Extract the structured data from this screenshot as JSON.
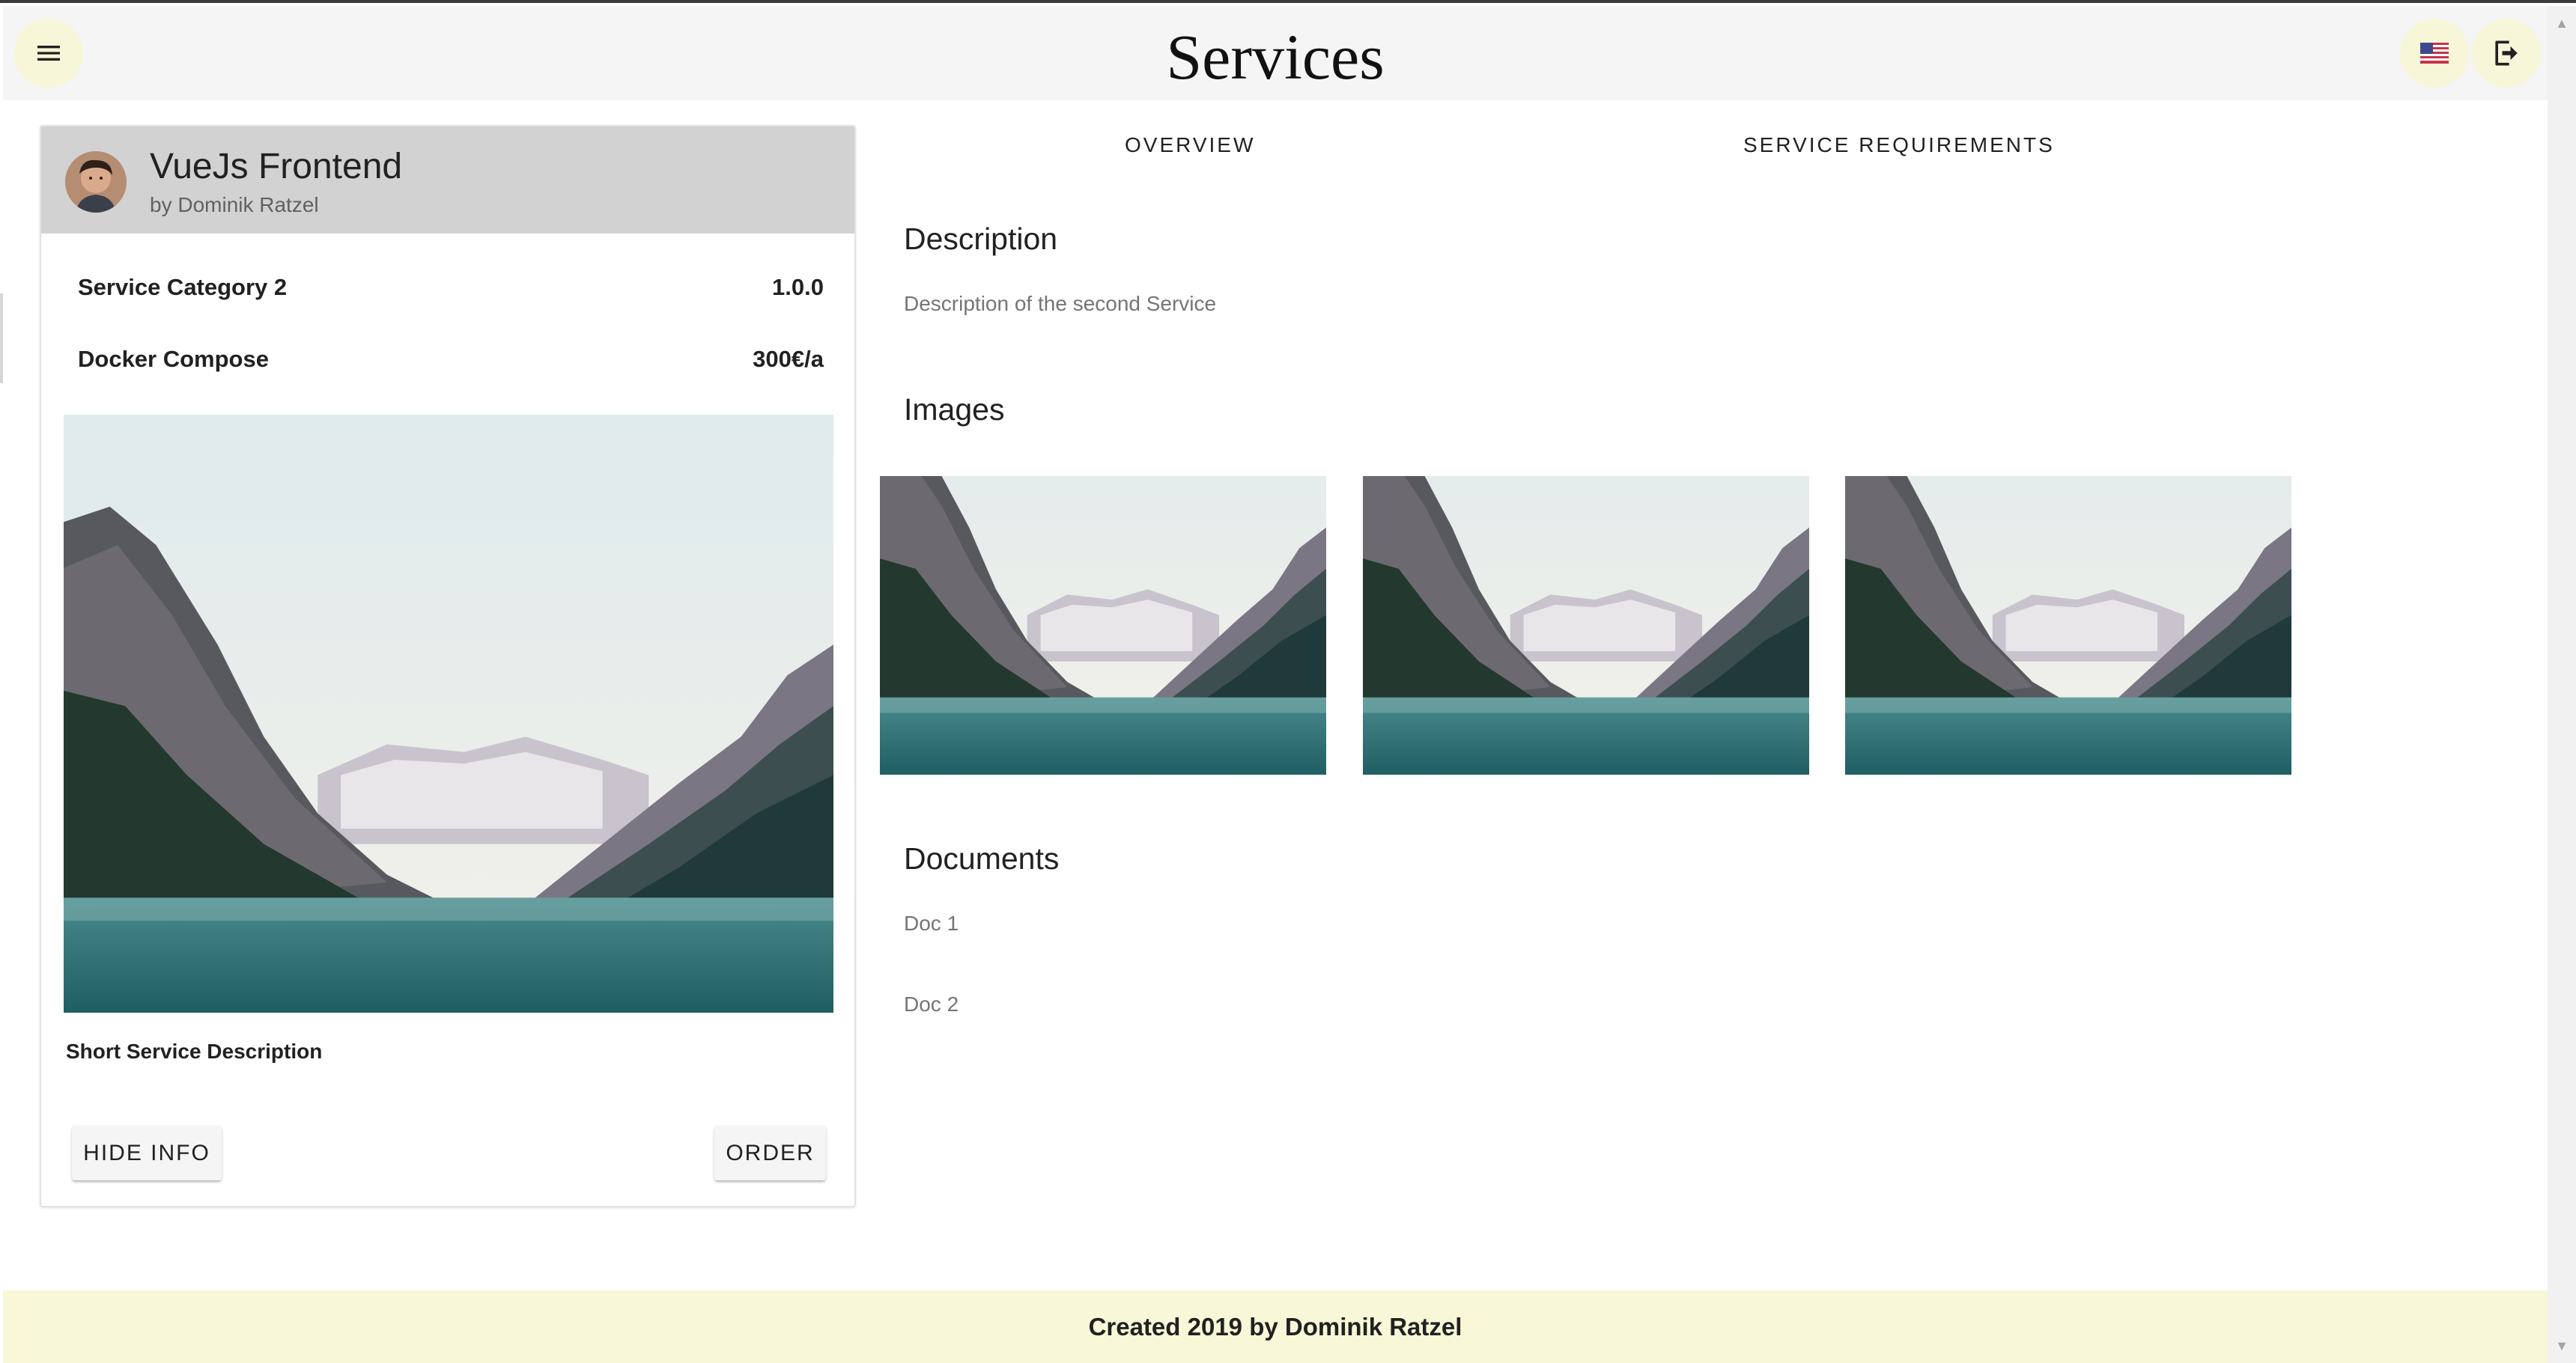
{
  "app_bar": {
    "title": "Services",
    "menu_icon": "menu-icon",
    "language_icon": "us-flag-icon",
    "logout_icon": "logout-icon",
    "accent_color": "#f7f6d8"
  },
  "service_card": {
    "title": "VueJs Frontend",
    "author": "by Dominik Ratzel",
    "category": "Service Category 2",
    "version": "1.0.0",
    "deployment": "Docker Compose",
    "price": "300€/a",
    "short_description": "Short Service Description",
    "hide_info_label": "HIDE INFO",
    "order_label": "ORDER"
  },
  "tabs": [
    {
      "label": "OVERVIEW"
    },
    {
      "label": "SERVICE REQUIREMENTS"
    }
  ],
  "overview": {
    "description_title": "Description",
    "description_text": "Description of the second Service",
    "images_title": "Images",
    "documents_title": "Documents",
    "documents": [
      "Doc 1",
      "Doc 2"
    ]
  },
  "footer": {
    "text": "Created 2019 by Dominik Ratzel"
  }
}
